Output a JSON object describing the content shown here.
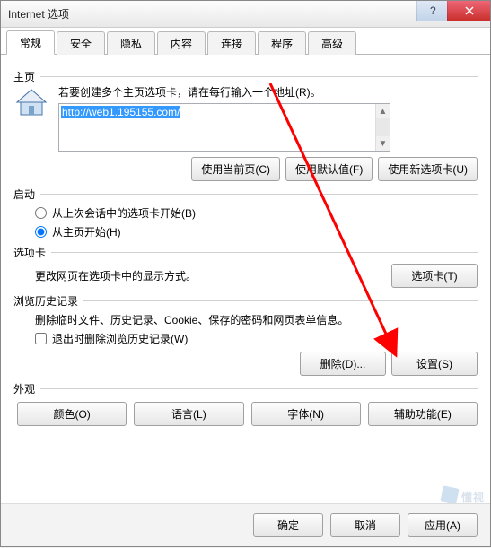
{
  "window": {
    "title": "Internet 选项"
  },
  "tabs": [
    "常规",
    "安全",
    "隐私",
    "内容",
    "连接",
    "程序",
    "高级"
  ],
  "active_tab": 0,
  "homepage": {
    "label": "主页",
    "desc": "若要创建多个主页选项卡，请在每行输入一个地址(R)。",
    "url": "http://web1.195155.com/",
    "btn_current": "使用当前页(C)",
    "btn_default": "使用默认值(F)",
    "btn_newtab": "使用新选项卡(U)"
  },
  "startup": {
    "label": "启动",
    "opt_last": "从上次会话中的选项卡开始(B)",
    "opt_home": "从主页开始(H)"
  },
  "tabsection": {
    "label": "选项卡",
    "desc": "更改网页在选项卡中的显示方式。",
    "btn": "选项卡(T)"
  },
  "history": {
    "label": "浏览历史记录",
    "desc": "删除临时文件、历史记录、Cookie、保存的密码和网页表单信息。",
    "chk": "退出时删除浏览历史记录(W)",
    "btn_delete": "删除(D)...",
    "btn_settings": "设置(S)"
  },
  "appearance": {
    "label": "外观",
    "btn_color": "颜色(O)",
    "btn_lang": "语言(L)",
    "btn_font": "字体(N)",
    "btn_access": "辅助功能(E)"
  },
  "footer": {
    "ok": "确定",
    "cancel": "取消",
    "apply": "应用(A)"
  },
  "watermark": "懂视"
}
